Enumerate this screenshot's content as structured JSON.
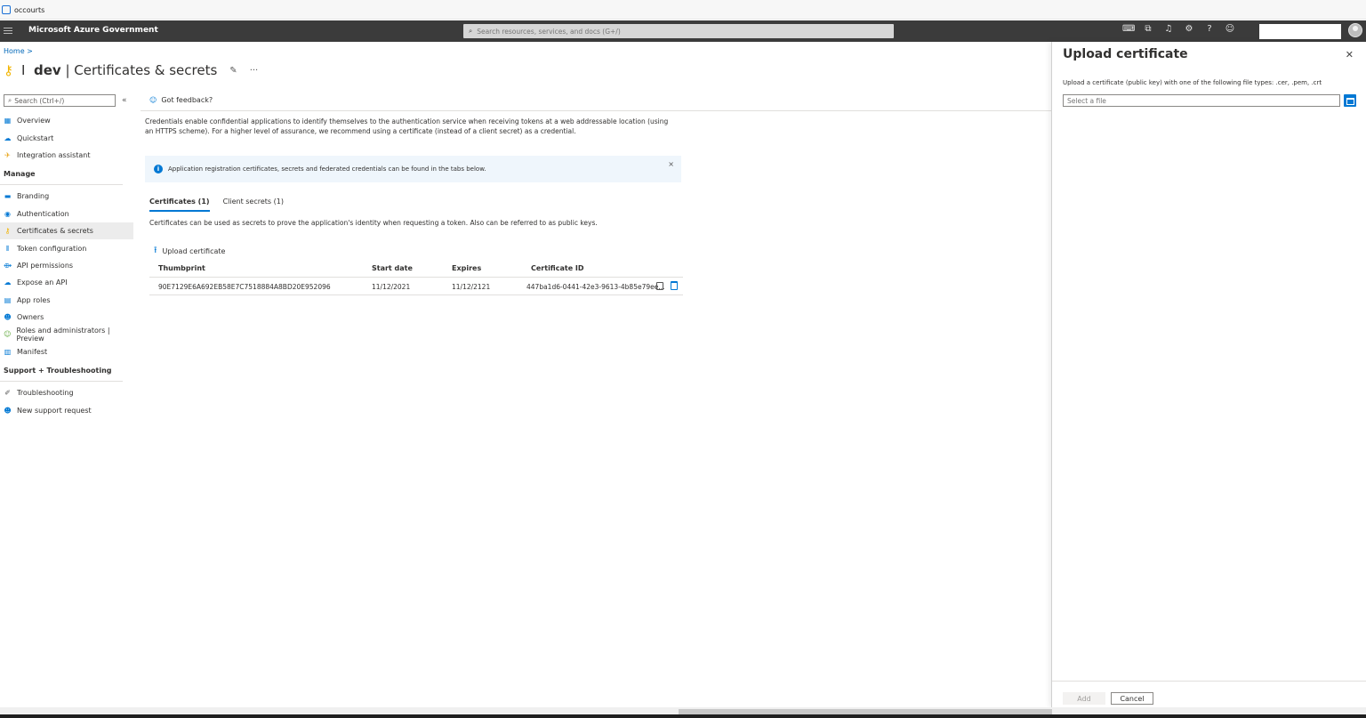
{
  "browser": {
    "tab_title": "occourts"
  },
  "header": {
    "brand": "Microsoft Azure Government",
    "search_placeholder": "Search resources, services, and docs (G+/)",
    "icons": [
      "terminal-icon",
      "directory-filter-icon",
      "bell-icon",
      "gear-icon",
      "help-icon",
      "feedback-icon"
    ]
  },
  "page": {
    "breadcrumb": "Home >",
    "title_name": "dev",
    "title_rest": " | Certificates & secrets",
    "title_prefix": "I"
  },
  "sidebar": {
    "search_placeholder": "Search (Ctrl+/)",
    "collapse": "«",
    "top_items": [
      {
        "label": "Overview",
        "icon": "grid-icon",
        "color": "#0078d4"
      },
      {
        "label": "Quickstart",
        "icon": "cloud-icon",
        "color": "#0078d4"
      },
      {
        "label": "Integration assistant",
        "icon": "rocket-icon",
        "color": "#e8a317"
      }
    ],
    "manage_header": "Manage",
    "manage_items": [
      {
        "label": "Branding",
        "icon": "branding-icon",
        "color": "#0078d4"
      },
      {
        "label": "Authentication",
        "icon": "authentication-icon",
        "color": "#0078d4"
      },
      {
        "label": "Certificates & secrets",
        "icon": "key-icon",
        "color": "#f2b400"
      },
      {
        "label": "Token configuration",
        "icon": "token-icon",
        "color": "#0078d4"
      },
      {
        "label": "API permissions",
        "icon": "permissions-icon",
        "color": "#0078d4"
      },
      {
        "label": "Expose an API",
        "icon": "cloud-api-icon",
        "color": "#0078d4"
      },
      {
        "label": "App roles",
        "icon": "app-roles-icon",
        "color": "#0078d4"
      },
      {
        "label": "Owners",
        "icon": "owners-icon",
        "color": "#0078d4"
      },
      {
        "label": "Roles and administrators | Preview",
        "icon": "roles-icon",
        "color": "#5ea83a"
      },
      {
        "label": "Manifest",
        "icon": "manifest-icon",
        "color": "#0078d4"
      }
    ],
    "support_header": "Support + Troubleshooting",
    "support_items": [
      {
        "label": "Troubleshooting",
        "icon": "wrench-icon",
        "color": "#555555"
      },
      {
        "label": "New support request",
        "icon": "support-person-icon",
        "color": "#0078d4"
      }
    ]
  },
  "main": {
    "feedback": "Got feedback?",
    "description": "Credentials enable confidential applications to identify themselves to the authentication service when receiving tokens at a web addressable location (using an HTTPS scheme). For a higher level of assurance, we recommend using a certificate (instead of a client secret) as a credential.",
    "info_text": "Application registration certificates, secrets and federated credentials can be found in the tabs below.",
    "tabs": [
      {
        "label": "Certificates (1)"
      },
      {
        "label": "Client secrets (1)"
      }
    ],
    "tab_description": "Certificates can be used as secrets to prove the application's identity when requesting a token. Also can be referred to as public keys.",
    "upload_label": "Upload certificate",
    "table": {
      "columns": [
        "Thumbprint",
        "Start date",
        "Expires",
        "Certificate ID"
      ],
      "rows": [
        {
          "thumbprint": "90E7129E6A692EB58E7C7518884A8BD20E952096",
          "start": "11/12/2021",
          "expires": "11/12/2121",
          "id": "447ba1d6-0441-42e3-9613-4b85e79ee..."
        }
      ]
    }
  },
  "blade": {
    "title": "Upload certificate",
    "description": "Upload a certificate (public key) with one of the following file types: .cer, .pem, .crt",
    "file_placeholder": "Select a file",
    "add_label": "Add",
    "cancel_label": "Cancel"
  }
}
